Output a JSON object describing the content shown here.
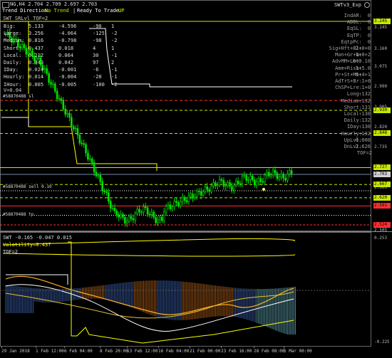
{
  "chart_header": {
    "symbol_line": "NG,H4  2.704 2.709 2.697 2.703",
    "trend_label": "Trend Direction:",
    "trend_value": "No Trend",
    "ready_label": "Ready To Trade:",
    "ready_value": "UP",
    "indicator_name": "SWTv3_Exp",
    "sub_title": "SWT_SRLvl_TOF=2"
  },
  "stats_table": {
    "rows": [
      {
        "label": "Big:",
        "a": "5.133",
        "b": "-4.596",
        "c": "-90",
        "d": "1"
      },
      {
        "label": "Large:",
        "a": "3.256",
        "b": "-4.064",
        "c": "-125",
        "d": "-2"
      },
      {
        "label": "Medium:",
        "a": "0.816",
        "c2": "-0.798",
        "c": "-98",
        "d": "-2"
      },
      {
        "label": "Short:",
        "a": "0.437",
        "b": "0.018",
        "c": "4",
        "d": "1"
      },
      {
        "label": "Local:",
        "a": "0.212",
        "b": "0.064",
        "c": "30",
        "d": "-1"
      },
      {
        "label": "Daily:",
        "a": "0.043",
        "b": "0.042",
        "c": "97",
        "d": "2"
      },
      {
        "label": "IDay:",
        "a": "0.024",
        "b": "-0.001",
        "c": "-6",
        "d": "-1"
      },
      {
        "label": "Hourly:",
        "a": "0.014",
        "b": "-0.004",
        "c": "-28",
        "d": "-1"
      },
      {
        "label": "IHour:",
        "a": "0.005",
        "b": "-0.005",
        "c": "-100",
        "d": "-2"
      }
    ],
    "v_line": "V=0.04"
  },
  "right_panel": [
    {
      "label": "IndAR:",
      "value": "0"
    },
    {
      "label": "ADDL:",
      "value": "0"
    },
    {
      "label": "EqSL:",
      "value": "0"
    },
    {
      "label": "EqTP:",
      "value": "0"
    },
    {
      "label": "EqtpPc:",
      "value": "0"
    },
    {
      "label": "Sig+Hft+Bl:",
      "value": "2+0+0"
    },
    {
      "label": "Man+Gr+N:",
      "value": "1+0+2"
    },
    {
      "label": "AdvMM+Lot:",
      "value": "0+0.10"
    },
    {
      "label": "Amm+Risk:",
      "value": "1+5.0"
    },
    {
      "label": "Pr+St+Mt:",
      "value": "6+4+1"
    },
    {
      "label": "AdTrS+Br:",
      "value": "1+0"
    },
    {
      "label": "ChSP+Lre:",
      "value": "1+0"
    },
    {
      "label": "Long:",
      "value": "-132"
    },
    {
      "label": "Medium:",
      "value": "-132"
    },
    {
      "label": "Short:",
      "value": "131"
    },
    {
      "label": "Local:",
      "value": "-130"
    },
    {
      "label": "Daily:",
      "value": "132"
    },
    {
      "label": "IDay:",
      "value": "-130"
    },
    {
      "label": "Hourly:",
      "value": "132"
    },
    {
      "label": "UpLvl:",
      "value": "0.000"
    },
    {
      "label": "DnLvl:",
      "value": "2.626"
    },
    {
      "label": "TOF=2",
      "value": ""
    }
  ],
  "price_axis": [
    "3.245",
    "3.160",
    "3.075",
    "2.990",
    "2.905",
    "2.820",
    "2.735",
    "2.650",
    "2.565",
    "2.505"
  ],
  "price_tags": [
    {
      "text": "3.245",
      "bg": "#c8e600"
    },
    {
      "text": "2.930",
      "bg": "#c8e600"
    },
    {
      "text": "2.848",
      "bg": "#c8e600"
    },
    {
      "text": "2.727",
      "bg": "#c8e600"
    },
    {
      "text": "2.703",
      "bg": "#d0d0d0"
    },
    {
      "text": "2.667",
      "bg": "#c8e600"
    },
    {
      "text": "2.620",
      "bg": "#c8e600"
    },
    {
      "text": "2.591",
      "bg": "#ff3030"
    },
    {
      "text": "2.524",
      "bg": "#ff3030"
    }
  ],
  "line_labels": {
    "sl_top": "#58870488 sl",
    "tp_mid": "#58870488 sell 0.10",
    "tp_bottom": "#58870488 tp"
  },
  "sub_window": {
    "title": "SWT -0.165 -0.047 0.015",
    "volatility": "Volatility=0.437",
    "tof": "TOF=2",
    "axis_top": "0.253",
    "axis_bottom": "-0.225"
  },
  "time_axis": [
    "29 Jan 2018",
    "1 Feb 12:00",
    "6 Feb 04:00",
    "8 Feb 20:00",
    "13 Feb 12:00",
    "16 Feb 04:00",
    "21 Feb 00:00",
    "23 Feb 16:00",
    "28 Feb 08:00",
    "5 Mar 00:00"
  ],
  "colors": {
    "candle": "#00e000",
    "accent": "#c8e600",
    "red": "#ff3030",
    "yellow": "#ffff00",
    "orange": "#ffa000"
  }
}
